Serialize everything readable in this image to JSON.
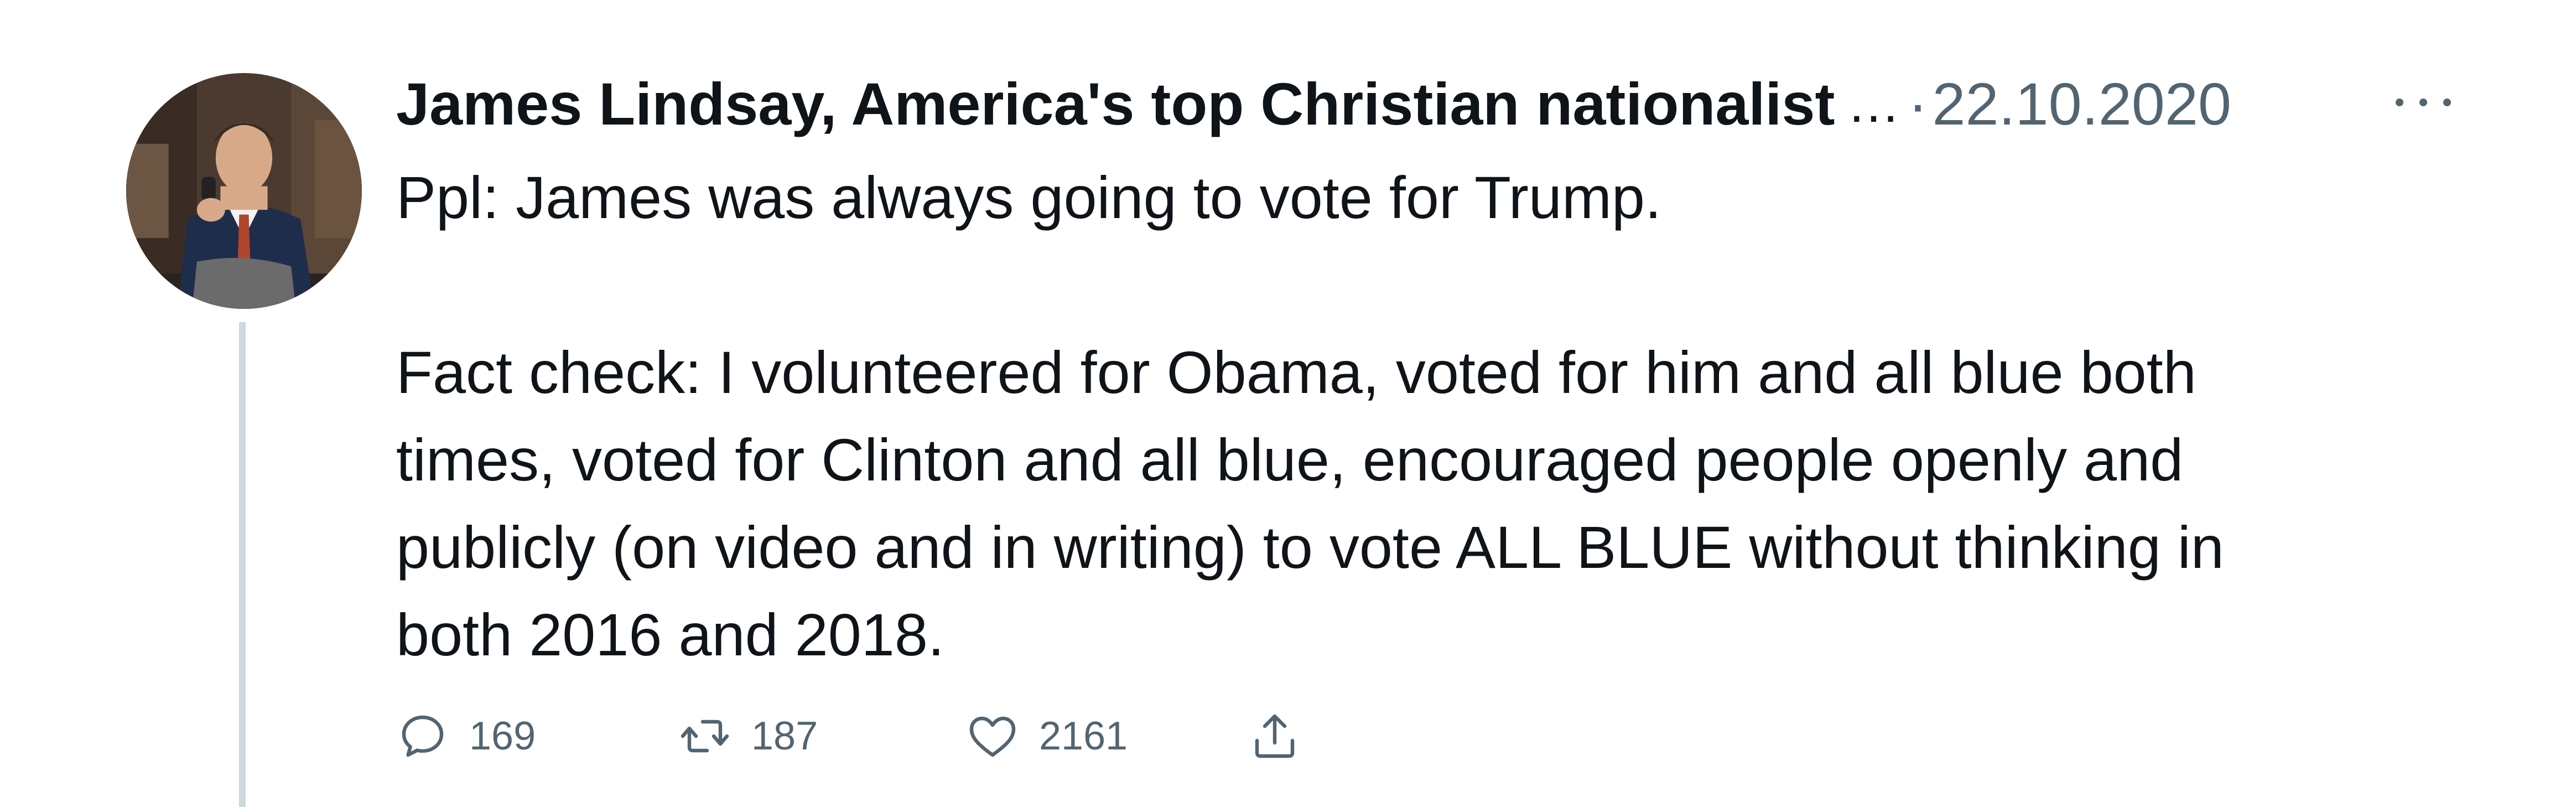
{
  "tweet": {
    "author": "James Lindsay, America's top Christian nationalist",
    "truncation": "...",
    "separator": "·",
    "date": "22.10.2020",
    "body_lines": [
      "Ppl: James was always going to vote for Trump.",
      "",
      "Fact check: I volunteered for Obama, voted for him and all blue both",
      "times, voted for Clinton and all blue, encouraged people openly and",
      "publicly (on video and in writing) to vote ALL BLUE without thinking in",
      "both 2016 and 2018."
    ],
    "stats": {
      "replies": "169",
      "retweets": "187",
      "likes": "2161"
    }
  },
  "icons": {
    "reply": "reply-bubble-icon",
    "retweet": "retweet-arrows-icon",
    "like": "heart-icon",
    "share": "share-upload-icon",
    "more": "more-dots-icon"
  },
  "colors": {
    "text_primary": "#0f1419",
    "text_secondary": "#536471",
    "thread_line": "#cfd9de",
    "background": "#ffffff"
  }
}
